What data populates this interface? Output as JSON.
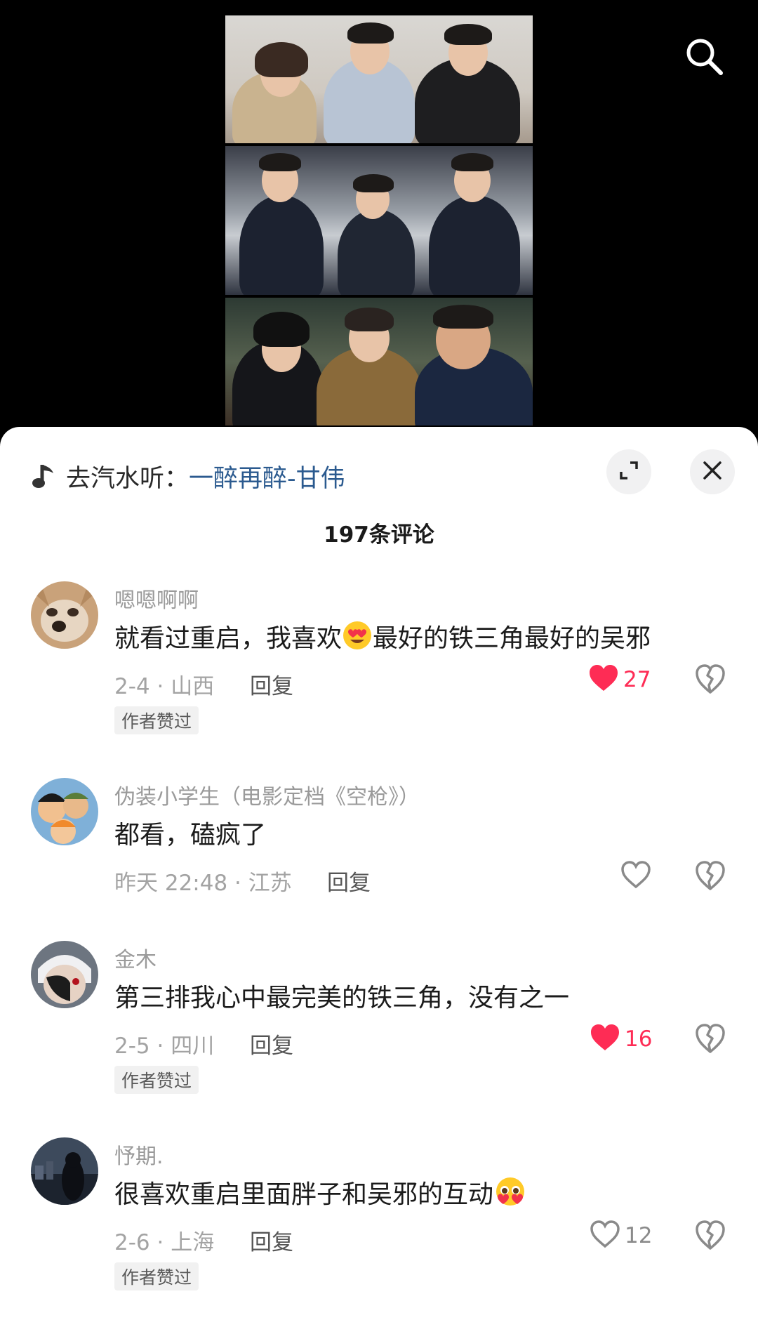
{
  "search": {
    "icon": "search-icon"
  },
  "video": {
    "description_icon": "video-photo-collage"
  },
  "music": {
    "prefix": "去汽水听：",
    "song": "一醉再醉-甘伟",
    "icon": "music-note-icon"
  },
  "header": {
    "comment_count": "197条评论"
  },
  "colors": {
    "link": "#2b5a8f",
    "liked": "#fe2c55",
    "muted": "#a3a3a3"
  },
  "comments": [
    {
      "username": "嗯嗯啊啊",
      "text_before": "就看过重启，我喜欢",
      "emoji": "heart-eyes-emoji",
      "text_after": "最好的铁三角最好的吴邪",
      "meta": "2-4 · 山西",
      "reply_label": "回复",
      "like_count": "27",
      "liked": true,
      "author_liked": "作者赞过"
    },
    {
      "username": "伪装小学生（电影定档《空枪》）",
      "text_before": "都看，磕疯了",
      "text_after": "",
      "meta": "昨天 22:48 · 江苏",
      "reply_label": "回复",
      "like_count": "",
      "liked": false,
      "author_liked": ""
    },
    {
      "username": "金木",
      "text_before": "第三排我心中最完美的铁三角，没有之一",
      "text_after": "",
      "meta": "2-5 · 四川",
      "reply_label": "回复",
      "like_count": "16",
      "liked": true,
      "author_liked": "作者赞过"
    },
    {
      "username": "忬期.",
      "text_before": "很喜欢重启里面胖子和吴邪的互动",
      "emoji": "pleading-face-emoji",
      "text_after": "",
      "meta": "2-6 · 上海",
      "reply_label": "回复",
      "like_count": "12",
      "liked": false,
      "author_liked": "作者赞过"
    }
  ]
}
